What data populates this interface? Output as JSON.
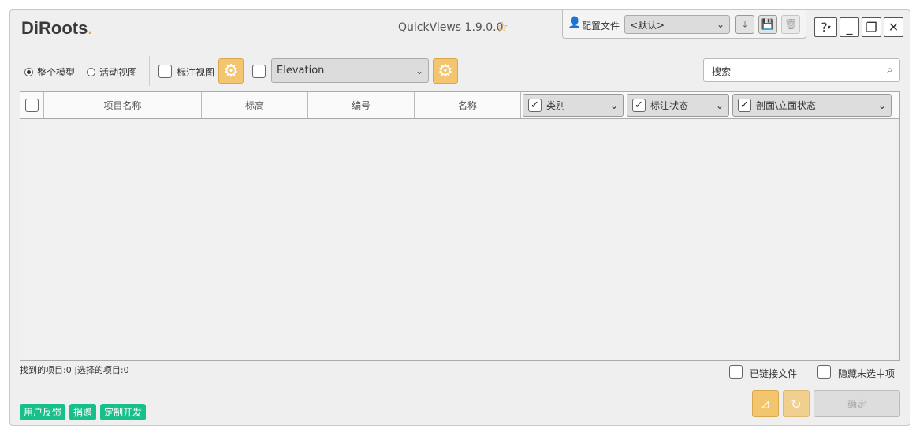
{
  "app": {
    "logo_main": "DiRoots",
    "logo_dot": ".",
    "title": "QuickViews 1.9.0.0"
  },
  "profile": {
    "label": "配置文件",
    "value": "<默认>"
  },
  "window_buttons": {
    "help": "?"
  },
  "toolbar": {
    "scope_options": [
      "整个模型",
      "活动视图"
    ],
    "selected_scope": 0,
    "annotate_label": "标注视图",
    "view_type": "Elevation"
  },
  "search": {
    "placeholder": "搜索"
  },
  "table": {
    "columns": [
      "项目名称",
      "标高",
      "编号",
      "名称"
    ],
    "filter_columns": [
      "类别",
      "标注状态",
      "剖面\\立面状态"
    ],
    "rows": []
  },
  "status": {
    "text": "找到的项目:0 |选择的项目:0"
  },
  "options": {
    "linked": "已链接文件",
    "hide_unselected": "隐藏未选中项"
  },
  "footer": {
    "tags": [
      "用户反馈",
      "捐赠",
      "定制开发"
    ],
    "ok": "确定"
  }
}
